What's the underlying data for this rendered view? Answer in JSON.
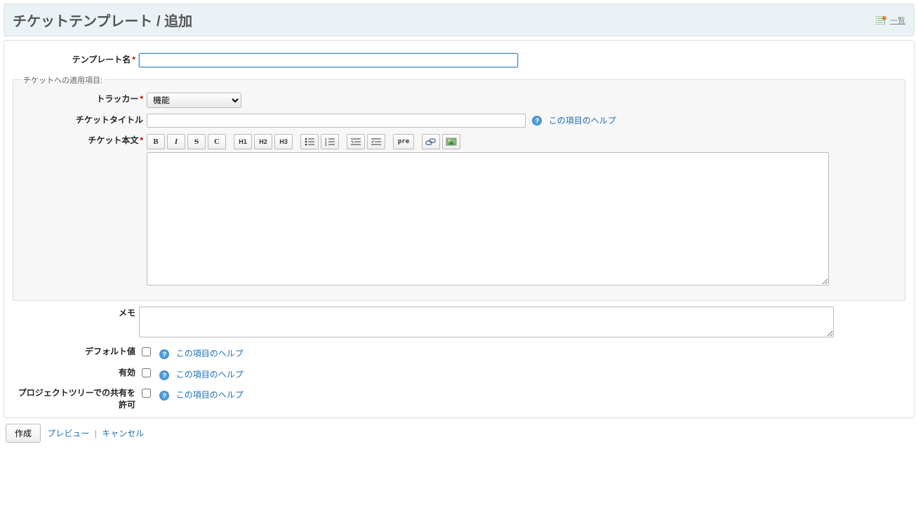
{
  "header": {
    "title": "チケットテンプレート / 追加",
    "contextual": {
      "list_label": "一覧"
    }
  },
  "form": {
    "labels": {
      "template_name": "テンプレート名",
      "tracker": "トラッカー",
      "issue_title": "チケットタイトル",
      "issue_body": "チケット本文",
      "memo": "メモ",
      "default": "デフォルト値",
      "enabled": "有効",
      "share_tree": "プロジェクトツリーでの共有を許可"
    },
    "fieldset_legend": "チケットへの適用項目:",
    "values": {
      "template_name": "",
      "tracker_selected": "機能",
      "issue_title": "",
      "issue_body": "",
      "memo": "",
      "default_checked": false,
      "enabled_checked": false,
      "share_tree_checked": false
    },
    "help_text": "この項目のヘルプ",
    "toolbar": {
      "bold": "B",
      "italic": "I",
      "strike": "S",
      "code_inline": "C",
      "h1": "H1",
      "h2": "H2",
      "h3": "H3",
      "ul": "ul",
      "ol": "ol",
      "unindent": "<=",
      "indent": "=>",
      "pre": "pre",
      "link": "link",
      "image": "img"
    }
  },
  "actions": {
    "submit": "作成",
    "preview": "プレビュー",
    "cancel": "キャンセル"
  }
}
